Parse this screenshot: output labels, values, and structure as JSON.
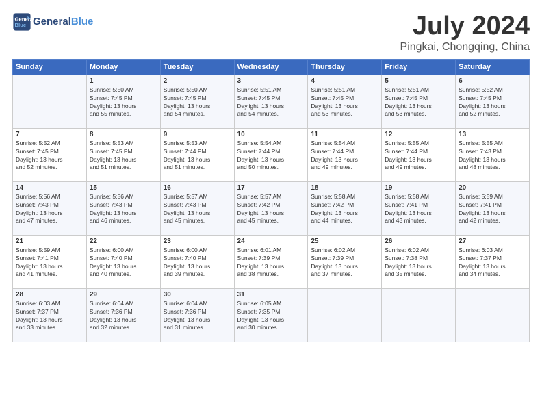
{
  "header": {
    "logo_line1a": "General",
    "logo_line1b": "Blue",
    "month": "July 2024",
    "location": "Pingkai, Chongqing, China"
  },
  "days_of_week": [
    "Sunday",
    "Monday",
    "Tuesday",
    "Wednesday",
    "Thursday",
    "Friday",
    "Saturday"
  ],
  "weeks": [
    [
      {
        "day": "",
        "info": ""
      },
      {
        "day": "1",
        "info": "Sunrise: 5:50 AM\nSunset: 7:45 PM\nDaylight: 13 hours\nand 55 minutes."
      },
      {
        "day": "2",
        "info": "Sunrise: 5:50 AM\nSunset: 7:45 PM\nDaylight: 13 hours\nand 54 minutes."
      },
      {
        "day": "3",
        "info": "Sunrise: 5:51 AM\nSunset: 7:45 PM\nDaylight: 13 hours\nand 54 minutes."
      },
      {
        "day": "4",
        "info": "Sunrise: 5:51 AM\nSunset: 7:45 PM\nDaylight: 13 hours\nand 53 minutes."
      },
      {
        "day": "5",
        "info": "Sunrise: 5:51 AM\nSunset: 7:45 PM\nDaylight: 13 hours\nand 53 minutes."
      },
      {
        "day": "6",
        "info": "Sunrise: 5:52 AM\nSunset: 7:45 PM\nDaylight: 13 hours\nand 52 minutes."
      }
    ],
    [
      {
        "day": "7",
        "info": "Sunrise: 5:52 AM\nSunset: 7:45 PM\nDaylight: 13 hours\nand 52 minutes."
      },
      {
        "day": "8",
        "info": "Sunrise: 5:53 AM\nSunset: 7:45 PM\nDaylight: 13 hours\nand 51 minutes."
      },
      {
        "day": "9",
        "info": "Sunrise: 5:53 AM\nSunset: 7:44 PM\nDaylight: 13 hours\nand 51 minutes."
      },
      {
        "day": "10",
        "info": "Sunrise: 5:54 AM\nSunset: 7:44 PM\nDaylight: 13 hours\nand 50 minutes."
      },
      {
        "day": "11",
        "info": "Sunrise: 5:54 AM\nSunset: 7:44 PM\nDaylight: 13 hours\nand 49 minutes."
      },
      {
        "day": "12",
        "info": "Sunrise: 5:55 AM\nSunset: 7:44 PM\nDaylight: 13 hours\nand 49 minutes."
      },
      {
        "day": "13",
        "info": "Sunrise: 5:55 AM\nSunset: 7:43 PM\nDaylight: 13 hours\nand 48 minutes."
      }
    ],
    [
      {
        "day": "14",
        "info": "Sunrise: 5:56 AM\nSunset: 7:43 PM\nDaylight: 13 hours\nand 47 minutes."
      },
      {
        "day": "15",
        "info": "Sunrise: 5:56 AM\nSunset: 7:43 PM\nDaylight: 13 hours\nand 46 minutes."
      },
      {
        "day": "16",
        "info": "Sunrise: 5:57 AM\nSunset: 7:43 PM\nDaylight: 13 hours\nand 45 minutes."
      },
      {
        "day": "17",
        "info": "Sunrise: 5:57 AM\nSunset: 7:42 PM\nDaylight: 13 hours\nand 45 minutes."
      },
      {
        "day": "18",
        "info": "Sunrise: 5:58 AM\nSunset: 7:42 PM\nDaylight: 13 hours\nand 44 minutes."
      },
      {
        "day": "19",
        "info": "Sunrise: 5:58 AM\nSunset: 7:41 PM\nDaylight: 13 hours\nand 43 minutes."
      },
      {
        "day": "20",
        "info": "Sunrise: 5:59 AM\nSunset: 7:41 PM\nDaylight: 13 hours\nand 42 minutes."
      }
    ],
    [
      {
        "day": "21",
        "info": "Sunrise: 5:59 AM\nSunset: 7:41 PM\nDaylight: 13 hours\nand 41 minutes."
      },
      {
        "day": "22",
        "info": "Sunrise: 6:00 AM\nSunset: 7:40 PM\nDaylight: 13 hours\nand 40 minutes."
      },
      {
        "day": "23",
        "info": "Sunrise: 6:00 AM\nSunset: 7:40 PM\nDaylight: 13 hours\nand 39 minutes."
      },
      {
        "day": "24",
        "info": "Sunrise: 6:01 AM\nSunset: 7:39 PM\nDaylight: 13 hours\nand 38 minutes."
      },
      {
        "day": "25",
        "info": "Sunrise: 6:02 AM\nSunset: 7:39 PM\nDaylight: 13 hours\nand 37 minutes."
      },
      {
        "day": "26",
        "info": "Sunrise: 6:02 AM\nSunset: 7:38 PM\nDaylight: 13 hours\nand 35 minutes."
      },
      {
        "day": "27",
        "info": "Sunrise: 6:03 AM\nSunset: 7:37 PM\nDaylight: 13 hours\nand 34 minutes."
      }
    ],
    [
      {
        "day": "28",
        "info": "Sunrise: 6:03 AM\nSunset: 7:37 PM\nDaylight: 13 hours\nand 33 minutes."
      },
      {
        "day": "29",
        "info": "Sunrise: 6:04 AM\nSunset: 7:36 PM\nDaylight: 13 hours\nand 32 minutes."
      },
      {
        "day": "30",
        "info": "Sunrise: 6:04 AM\nSunset: 7:36 PM\nDaylight: 13 hours\nand 31 minutes."
      },
      {
        "day": "31",
        "info": "Sunrise: 6:05 AM\nSunset: 7:35 PM\nDaylight: 13 hours\nand 30 minutes."
      },
      {
        "day": "",
        "info": ""
      },
      {
        "day": "",
        "info": ""
      },
      {
        "day": "",
        "info": ""
      }
    ]
  ]
}
